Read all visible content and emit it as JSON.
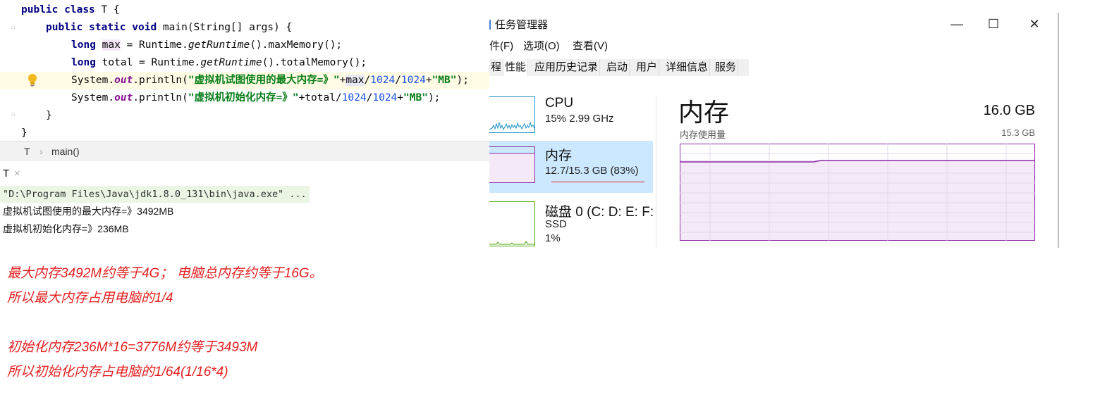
{
  "editor": {
    "lines": {
      "l1": [
        "public",
        "class",
        "T {"
      ],
      "l2": [
        "public",
        "static",
        "void",
        "main(String[] args) {"
      ],
      "l3": {
        "type": "long",
        "var": "max",
        "eq": " = Runtime.",
        "method": "getRuntime",
        "rest": "().maxMemory();"
      },
      "l4": {
        "type": "long",
        "var": "total",
        "eq": " = Runtime.",
        "method": "getRuntime",
        "rest": "().totalMemory();"
      },
      "l5": {
        "pre": "System.",
        "field": "out",
        "call": ".println(",
        "str": "\"虚拟机试图使用的最大内存=》\"",
        "op1": "+",
        "var": "max",
        "op2": "/",
        "n1": "1024",
        "op3": "/",
        "n2": "1024",
        "op4": "+",
        "str2": "\"MB\"",
        "end": ");"
      },
      "l6": {
        "pre": "System.",
        "field": "out",
        "call": ".println(",
        "str": "\"虚拟机初始化内存=》\"",
        "op1": "+total/",
        "n1": "1024",
        "op3": "/",
        "n2": "1024",
        "op4": "+",
        "str2": "\"MB\"",
        "end": ");"
      },
      "l7": "}",
      "l8": "}"
    }
  },
  "breadcrumb": {
    "cls": "T",
    "sep": "›",
    "method": "main()"
  },
  "run": {
    "tab": "T",
    "close": "×",
    "console": [
      "\"D:\\Program Files\\Java\\jdk1.8.0_131\\bin\\java.exe\" ...",
      "虚拟机试图使用的最大内存=》3492MB",
      "虚拟机初始化内存=》236MB"
    ]
  },
  "notes": [
    "最大内存3492M约等于4G； 电脑总内存约等于16G。",
    "所以最大内存占用电脑的1/4",
    "初始化内存236M*16=3776M约等于3493M",
    "所以初始化内存占电脑的1/64(1/16*4)"
  ],
  "taskmanager": {
    "title": "任务管理器",
    "window": {
      "min": "—",
      "max": "☐",
      "close": "✕"
    },
    "menu": [
      "件(F)",
      "选项(O)",
      "查看(V)"
    ],
    "tabs": [
      "程",
      "性能",
      "应用历史记录",
      "启动",
      "用户",
      "详细信息",
      "服务"
    ],
    "resources": [
      {
        "name": "CPU",
        "sub1": "15% 2.99 GHz",
        "sub2": ""
      },
      {
        "name": "内存",
        "sub1": "12.7/15.3 GB (83%)",
        "sub2": ""
      },
      {
        "name": "磁盘 0 (C: D: E: F:",
        "sub1": "SSD",
        "sub2": "1%"
      }
    ],
    "detail": {
      "title": "内存",
      "total": "16.0 GB",
      "usage_label": "内存使用量",
      "usage_max": "15.3 GB",
      "usage_fraction": 0.83
    },
    "colors": {
      "cpu": "#1a91c7",
      "memory": "#8b2ba8",
      "disk": "#4da60c",
      "selected_bg": "#cce8ff"
    }
  }
}
